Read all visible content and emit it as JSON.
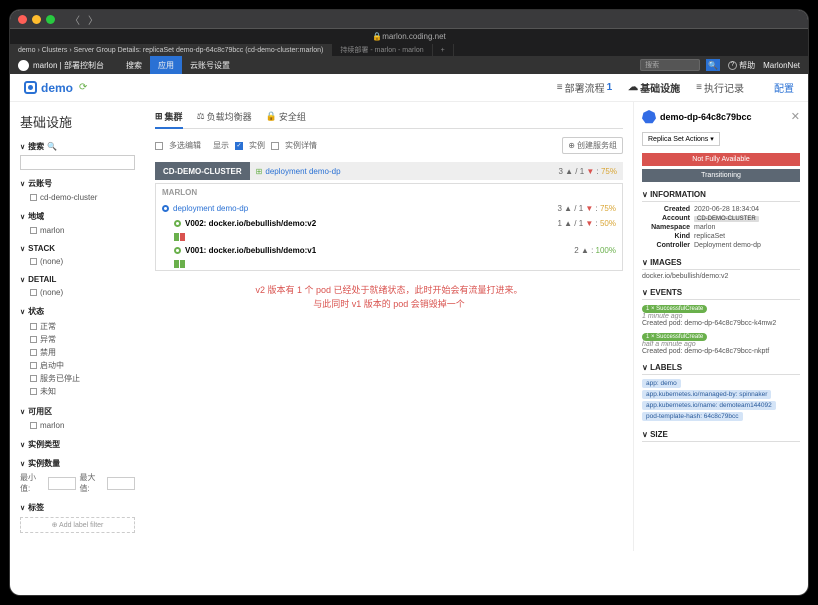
{
  "url": "marlon.coding.net",
  "tabs": {
    "active": "demo › Clusters › Server Group Details: replicaSet demo-dp-64c8c79bcc (cd-demo-cluster:marlon)",
    "inactive": "持续部署 - marlon - marlon"
  },
  "brand": "marlon | 部署控制台",
  "nav": {
    "search": "搜索",
    "app": "应用",
    "account": "云账号设置",
    "searchPlaceholder": "搜索"
  },
  "help": "帮助",
  "user": "MarlonNet",
  "app": {
    "name": "demo"
  },
  "headtabs": {
    "flow": "部署流程",
    "flowCount": "1",
    "infra": "基础设施",
    "tasks": "执行记录",
    "config": "配置"
  },
  "page": {
    "title": "基础设施"
  },
  "subnav": {
    "cluster": "集群",
    "lb": "负载均衡器",
    "sg": "安全组"
  },
  "sidebar": {
    "search": "搜索",
    "accounts": {
      "title": "云账号",
      "items": [
        "cd-demo-cluster"
      ]
    },
    "region": {
      "title": "地域",
      "items": [
        "marlon"
      ]
    },
    "stack": {
      "title": "STACK",
      "items": [
        "(none)"
      ]
    },
    "detail": {
      "title": "DETAIL",
      "items": [
        "(none)"
      ]
    },
    "status": {
      "title": "状态",
      "items": [
        "正常",
        "异常",
        "禁用",
        "启动中",
        "服务已停止",
        "未知"
      ]
    },
    "az": {
      "title": "可用区",
      "items": [
        "marlon"
      ]
    },
    "instType": {
      "title": "实例类型"
    },
    "instCount": {
      "title": "实例数量",
      "min": "最小值:",
      "max": "最大值:"
    },
    "labels": {
      "title": "标签",
      "add": "Add label filter"
    }
  },
  "toolbar": {
    "multi": "多选编辑",
    "show": "显示",
    "instance": "实例",
    "detail": "实例详情",
    "create": "创建服务组"
  },
  "cluster": {
    "badge": "CD-DEMO-CLUSTER",
    "deploy": "deployment demo-dp",
    "stats": "3 ▲ / 1 ▼ : 75%"
  },
  "box": {
    "header": "MARLON",
    "r1": {
      "name": "deployment demo-dp",
      "stats": "3 ▲ / 1 ▼ : ",
      "pct": "75%"
    },
    "r2": {
      "name": "V002: docker.io/bebullish/demo:v2",
      "stats": "1 ▲ / 1 ▼ : ",
      "pct": "50%"
    },
    "r3": {
      "name": "V001: docker.io/bebullish/demo:v1",
      "stats": "2 ▲ : ",
      "pct": "100%"
    }
  },
  "note": {
    "l1": "v2 版本有 1 个 pod 已经处于就绪状态，此时开始会有流量打进来。",
    "l2": "与此同时 v1 版本的 pod 会销毁掉一个"
  },
  "detail": {
    "title": "demo-dp-64c8c79bcc",
    "action": "Replica Set Actions ▾",
    "status1": "Not Fully Available",
    "status2": "Transitioning",
    "info": {
      "h": "INFORMATION",
      "created": "2020-06-28 18:34:04",
      "createdK": "Created",
      "account": "CD-DEMO-CLUSTER",
      "accountK": "Account",
      "ns": "marlon",
      "nsK": "Namespace",
      "kind": "replicaSet",
      "kindK": "Kind",
      "ctrl": "Deployment demo-dp",
      "ctrlK": "Controller"
    },
    "images": {
      "h": "IMAGES",
      "v": "docker.io/bebullish/demo:v2"
    },
    "events": {
      "h": "EVENTS",
      "tag": "1 × SuccessfulCreate",
      "t1": "1 minute ago",
      "m1": "Created pod: demo-dp-64c8c79bcc-k4mw2",
      "t2": "half a minute ago",
      "m2": "Created pod: demo-dp-64c8c79bcc-nkptf"
    },
    "labels": {
      "h": "LABELS",
      "items": [
        "app: demo",
        "app.kubernetes.io/managed-by: spinnaker",
        "app.kubernetes.io/name: demoteam144092",
        "pod-template-hash: 64c8c79bcc"
      ]
    },
    "size": {
      "h": "SIZE"
    }
  }
}
